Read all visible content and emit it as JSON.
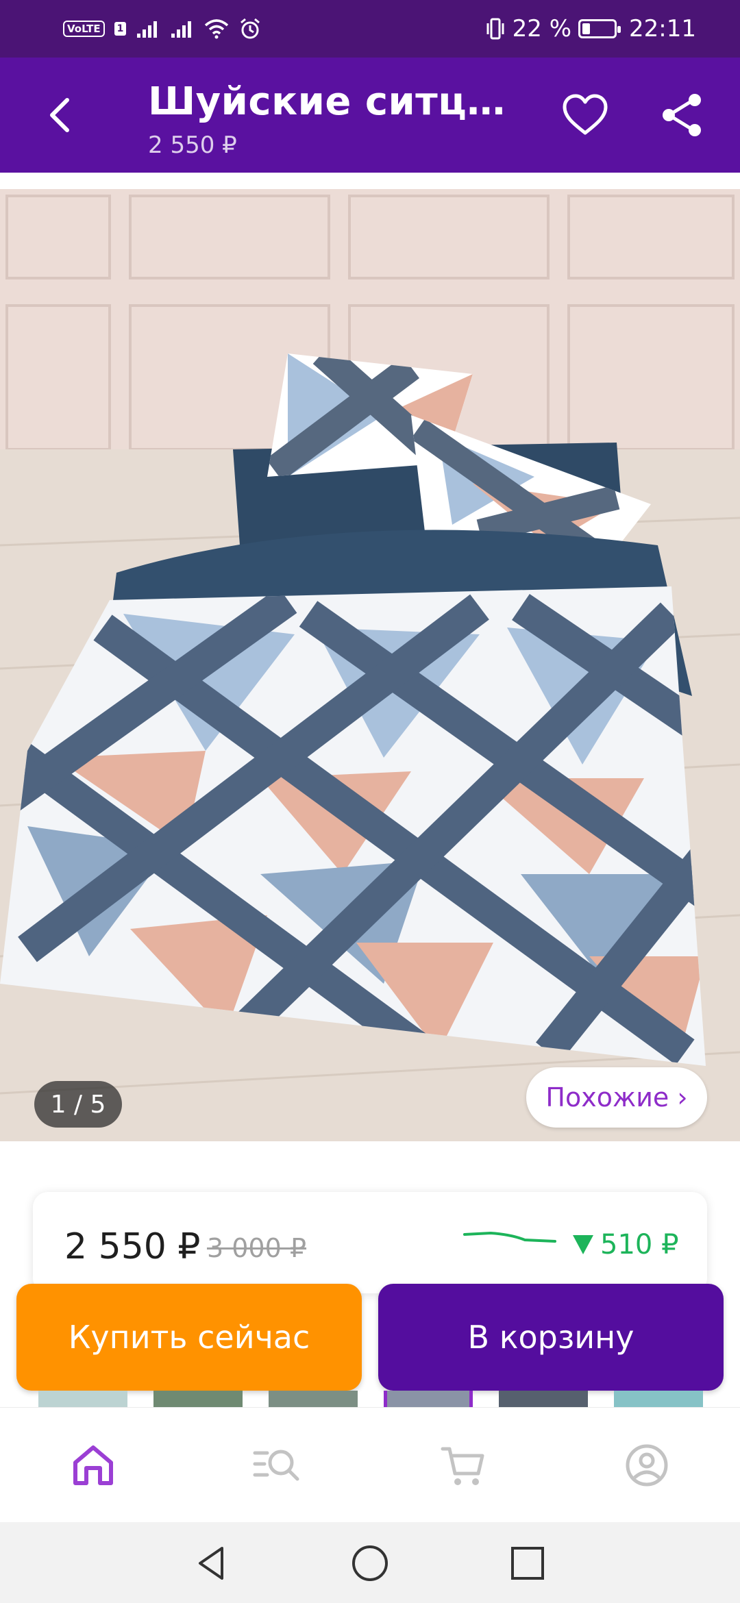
{
  "status_bar": {
    "volte": "VoLTE",
    "sim": "1",
    "battery_percent": "22 %",
    "battery_level": 0.22,
    "time": "22:11"
  },
  "app_bar": {
    "title": "Шуйские ситцы ...",
    "subtitle": "2 550 ₽",
    "icons": [
      "back-arrow-icon",
      "heart-icon",
      "share-icon"
    ]
  },
  "gallery": {
    "counter": "1 / 5",
    "similar_label": "Похожие ›"
  },
  "price": {
    "current": "2 550 ₽",
    "old": "3 000 ₽",
    "drop": "510 ₽",
    "drop_color": "#1db45a"
  },
  "actions": {
    "buy_now": "Купить сейчас",
    "add_to_cart": "В корзину",
    "buy_color": "#ff9200",
    "cart_color": "#540d9e"
  },
  "bottom_nav": {
    "items": [
      "home-icon",
      "catalog-search-icon",
      "cart-icon",
      "profile-icon"
    ],
    "active": "home-icon",
    "active_color": "#9b3fd4"
  },
  "colors": {
    "status_bar": "#4b1475",
    "app_bar": "#5a11a0"
  }
}
